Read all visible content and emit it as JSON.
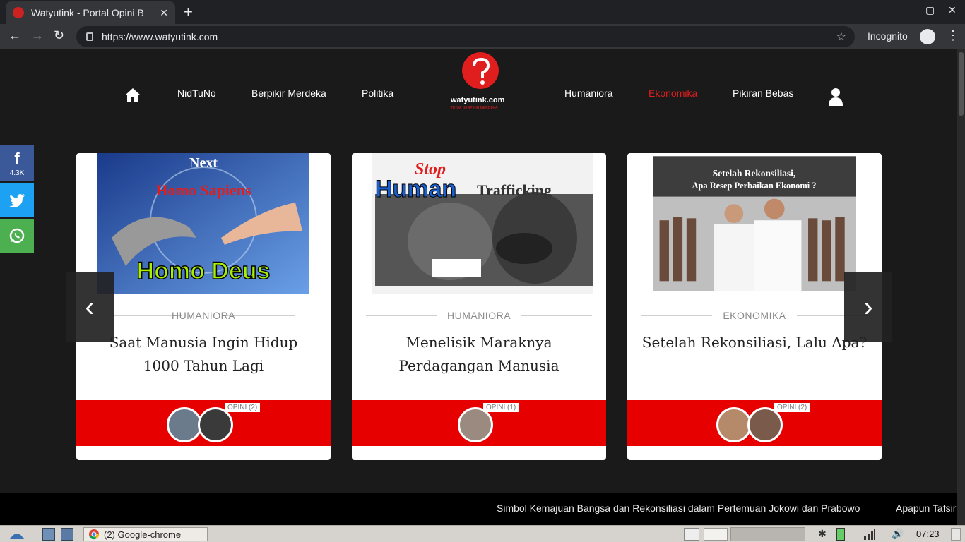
{
  "browser": {
    "tab_title": "Watyutink - Portal Opini B",
    "url": "https://www.watyutink.com",
    "incognito_label": "Incognito"
  },
  "site": {
    "logo_text": "watyutink.com",
    "logo_tagline": "TETAP BERPIKIR MERDEKA",
    "nav": [
      "NidTuNo",
      "Berpikir Merdeka",
      "Politika",
      "Humaniora",
      "Ekonomika",
      "Pikiran Bebas"
    ],
    "active_nav": "Ekonomika",
    "accent": "#e01e1e"
  },
  "share": {
    "facebook_count": "4.3K"
  },
  "cards": [
    {
      "category": "HUMANIORA",
      "title": "Saat Manusia Ingin Hidup 1000 Tahun Lagi",
      "opini": "OPINI (2)",
      "image_text": [
        "Next",
        "Homo Sapiens",
        "Homo Deus"
      ]
    },
    {
      "category": "HUMANIORA",
      "title": "Menelisik Maraknya Perdagangan Manusia",
      "opini": "OPINI (1)",
      "image_text": [
        "Stop",
        "Human",
        "Trafficking"
      ]
    },
    {
      "category": "EKONOMIKA",
      "title": "Setelah Rekonsiliasi, Lalu Apa?",
      "opini": "OPINI (2)",
      "image_text": [
        "Setelah Rekonsiliasi,",
        "Apa Resep Perbaikan Ekonomi ?"
      ]
    }
  ],
  "ticker": [
    "Simbol Kemajuan Bangsa dan Rekonsiliasi dalam Pertemuan Jokowi dan Prabowo",
    "Apapun Tafsir"
  ],
  "taskbar": {
    "app_label": "(2) Google-chrome",
    "clock": "07:23"
  }
}
